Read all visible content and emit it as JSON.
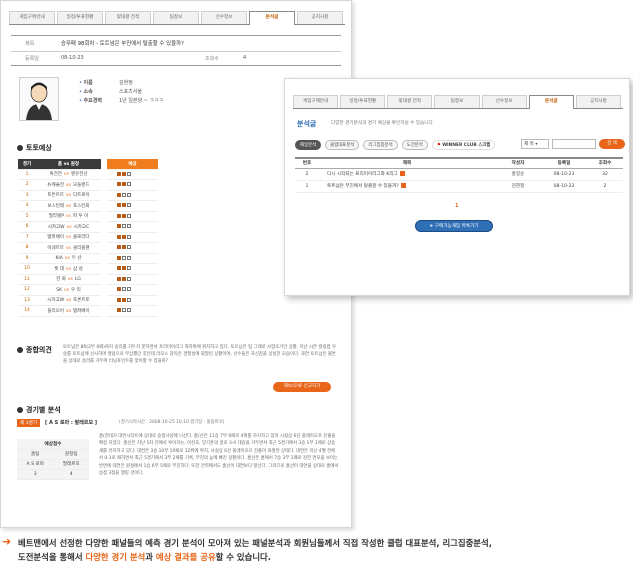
{
  "left_panel": {
    "tabs": [
      "게임구매안내",
      "일정/투표현황",
      "맞대결 전적",
      "팀정보",
      "선수정보",
      "분석글",
      "공지사항"
    ],
    "active_tab": 5,
    "title_label": "제목",
    "title": "승무패 98회차 - 토트넘은 부진에서 탈출할 수 있을까?",
    "date_label": "등록일",
    "date": "08-10-23",
    "views_label": "조회수",
    "views": "4",
    "profile": {
      "name_label": "이름",
      "name": "김현정",
      "team_label": "소속",
      "team": "스포츠서울",
      "career_label": "주요경력",
      "career": "1년 일본양 ~ ㅋㅋㅋ"
    },
    "toto_title": "토토예상",
    "table_head": {
      "game": "경기",
      "home": "홈 vs 원정",
      "forecast": "예상"
    },
    "games": [
      {
        "n": "1",
        "h": "위건전",
        "a": "맨유전선"
      },
      {
        "n": "2",
        "h": "뉴캐슬전",
        "a": "모들랜드"
      },
      {
        "n": "3",
        "h": "토튼트트",
        "a": "디트로이"
      },
      {
        "n": "4",
        "h": "보스턴레",
        "a": "포스턴회"
      },
      {
        "n": "5",
        "h": "필라델P",
        "a": "파 투 이"
      },
      {
        "n": "6",
        "h": "시카고W",
        "a": "시카고C"
      },
      {
        "n": "7",
        "h": "탬파베이",
        "a": "콜로라다"
      },
      {
        "n": "8",
        "h": "미네트트",
        "a": "클리블랜"
      },
      {
        "n": "9",
        "h": "KIA",
        "a": "두 산"
      },
      {
        "n": "10",
        "h": "롯 데",
        "a": "삼 성"
      },
      {
        "n": "11",
        "h": "한 화",
        "a": "LG"
      },
      {
        "n": "12",
        "h": "SK",
        "a": "우 리"
      },
      {
        "n": "13",
        "h": "시카고W",
        "a": "토론트토"
      },
      {
        "n": "14",
        "h": "플리모어",
        "a": "탬파베이"
      }
    ],
    "vs": "vs",
    "opinion_title": "종합의견",
    "opinion_text": "토트넘은 8R(2무 6패)까지 승리를 거두지 못하면서 프리미어리그 최하위에 위치하고 있다. 토트넘은 팀 그레로 사령조가인 상황. 지난 시즌 칼링컵 우승를 토트넘에 선사하며 명용으로 부상했던 후안데 라모스 감독은 경질설에 휘말린 상황이며, 선수들은 자신감을 상실한 모습이다. 과연 토트넘은 볼튼을 상대로 승리를 거두며 터닝포인트를 맞이할 수 있을까?",
    "report_button": "재보/오류 신고하기",
    "analysis_title": "경기별 분석",
    "match_badge": "제 3경기",
    "match_text": "[ A S 로마 : 팔레르모 ]",
    "match_time": "(경기시작시간 : 2008-10-25 10:10 경기장 : 올림피코)",
    "score_box": {
      "head": "예상점수",
      "home_h": "홈팀",
      "away_h": "원정팀",
      "home": "A S 로마",
      "away": "팔레르모",
      "home_score": "3",
      "away_score": "4"
    },
    "analysis_text": "홈(현대가 대연시티트에 상대로 승점사냥에 나선다. 홈(선은 11승 7무 6패로 4위를 차지하고 있어 시실상 6강 플레이오프 진출을 확정 지었다. 홈선은 지난 5차 전에서 루이지뉴, 이진호, 양기훈의 골로 3-0 대승을 거두면서 최근 5경기에서 3승 1무 1패로 상승세를 유지하고 있다. 대연은 3승 10무 10패로 12위에 위치, 사실상 6강 플레이오프 진출이 좌절된 상태다. 대연은 지난 4월 전에서 0-1로 패하면서 최근 5경기에서 3무 2패를 기록, 부진의 늪에 빠진 상황이다. 홈선은 홈에서 7승 3무 1패로 강한 면모을 보이는 반면에 대연은 원정에서 1승 6무 5패로 부진하다. 또한 전력에서도 홈선이 대연보다 앞선다. 그러므로 홈선이 대연을 상대로 홈에서 승점 3점을 챙길 것이다."
  },
  "right_panel": {
    "tabs": [
      "게임구매안내",
      "일정/투표현황",
      "맞대결 전적",
      "팀정보",
      "선수정보",
      "분석글",
      "공지사항"
    ],
    "active_tab": 5,
    "heading": "분석글",
    "heading_desc": "다양한 경기분석과 경기 예상을 확인하실 수 있습니다.",
    "sub_tabs": [
      "패널분석",
      "클럽대표분석",
      "리그집중분석",
      "도전분석"
    ],
    "club_badge": "WINNER CLUB 스크랩",
    "search_select": "제 목",
    "search_placeholder": "",
    "search_button": "검 색",
    "table_head": [
      "번호",
      "제목",
      "작성자",
      "등록일",
      "조회수"
    ],
    "rows": [
      {
        "no": "2",
        "title": "다시 시작되는 프리미어리그와 K리그",
        "author": "홍길순",
        "date": "08-10-23",
        "views": "32"
      },
      {
        "no": "1",
        "title": "토트넘은 부진에서 탈출할 수 있을까?",
        "author": "김현정",
        "date": "08-10-23",
        "views": "2"
      }
    ],
    "page": "1",
    "buy_button": "구매가능게임 목록가기"
  },
  "caption": {
    "line1_a": "베트맨에서 선정한 다양한 패널들의 예측 경기 분석이 모아져 있는 패널분석과 회원님들께서 직접 작성한 클럽 대표분석, 리그집중분석,",
    "line2_a": "도전분석을 통해서 ",
    "line2_hi1": "다양한 경기 분석",
    "line2_b": "과 ",
    "line2_hi2": "예상 결과를 공유",
    "line2_c": "할 수 있습니다."
  },
  "colors": {
    "accent": "#e8651a",
    "blue": "#2f6fb5",
    "dark": "#3a3a3a"
  }
}
